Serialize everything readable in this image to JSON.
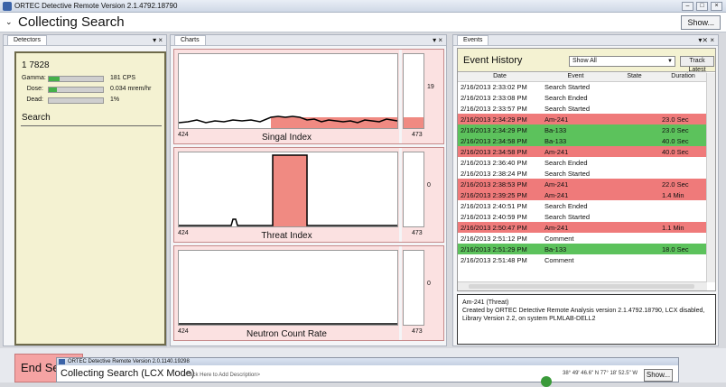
{
  "window": {
    "title": "ORTEC Detective Remote Version 2.1.4792.18790"
  },
  "header": {
    "title": "Collecting Search",
    "show_label": "Show..."
  },
  "panels": {
    "detectors": "Detectors",
    "charts": "Charts",
    "events": "Events",
    "pin": "▾ ×",
    "pin_events": "▾⨯ ×"
  },
  "detector": {
    "id": "1 7828",
    "search_label": "Search",
    "rows": [
      {
        "label": "Gamma:",
        "value": "181 CPS",
        "fill": 0.2
      },
      {
        "label": "Dose:",
        "value": "0.034 mrem/hr",
        "fill": 0.15
      },
      {
        "label": "Dead:",
        "value": "1%",
        "fill": 0
      }
    ]
  },
  "charts": [
    {
      "title": "Singal Index",
      "left": "424",
      "right": "473",
      "side_value": "19"
    },
    {
      "title": "Threat Index",
      "left": "424",
      "right": "473",
      "side_value": "0"
    },
    {
      "title": "Neutron Count Rate",
      "left": "424",
      "right": "473",
      "side_value": "0"
    }
  ],
  "events": {
    "title": "Event History",
    "filter": "Show All",
    "track_label": "Track Latest",
    "columns": [
      "Date",
      "Event",
      "State",
      "Duration"
    ],
    "rows": [
      {
        "date": "2/16/2013 2:33:02 PM",
        "event": "Search Started",
        "state": "",
        "duration": "",
        "color": "white"
      },
      {
        "date": "2/16/2013 2:33:08 PM",
        "event": "Search Ended",
        "state": "",
        "duration": "",
        "color": "white"
      },
      {
        "date": "2/16/2013 2:33:57 PM",
        "event": "Search Started",
        "state": "",
        "duration": "",
        "color": "white"
      },
      {
        "date": "2/16/2013 2:34:29 PM",
        "event": "Am-241",
        "state": "",
        "duration": "23.0 Sec",
        "color": "red"
      },
      {
        "date": "2/16/2013 2:34:29 PM",
        "event": "Ba-133",
        "state": "",
        "duration": "23.0 Sec",
        "color": "green"
      },
      {
        "date": "2/16/2013 2:34:58 PM",
        "event": "Ba-133",
        "state": "",
        "duration": "40.0 Sec",
        "color": "green"
      },
      {
        "date": "2/16/2013 2:34:58 PM",
        "event": "Am-241",
        "state": "",
        "duration": "40.0 Sec",
        "color": "red"
      },
      {
        "date": "2/16/2013 2:36:40 PM",
        "event": "Search Ended",
        "state": "",
        "duration": "",
        "color": "white"
      },
      {
        "date": "2/16/2013 2:38:24 PM",
        "event": "Search Started",
        "state": "",
        "duration": "",
        "color": "white"
      },
      {
        "date": "2/16/2013 2:38:53 PM",
        "event": "Am-241",
        "state": "",
        "duration": "22.0 Sec",
        "color": "red"
      },
      {
        "date": "2/16/2013 2:39:25 PM",
        "event": "Am-241",
        "state": "",
        "duration": "1.4 Min",
        "color": "red"
      },
      {
        "date": "2/16/2013 2:40:51 PM",
        "event": "Search Ended",
        "state": "",
        "duration": "",
        "color": "white"
      },
      {
        "date": "2/16/2013 2:40:59 PM",
        "event": "Search Started",
        "state": "",
        "duration": "",
        "color": "white"
      },
      {
        "date": "2/16/2013 2:50:47 PM",
        "event": "Am-241",
        "state": "",
        "duration": "1.1 Min",
        "color": "red"
      },
      {
        "date": "2/16/2013 2:51:12 PM",
        "event": "Comment",
        "state": "",
        "duration": "",
        "color": "white"
      },
      {
        "date": "2/16/2013 2:51:29 PM",
        "event": "Ba-133",
        "state": "",
        "duration": "18.0 Sec",
        "color": "green"
      },
      {
        "date": "2/16/2013 2:51:48 PM",
        "event": "Comment",
        "state": "",
        "duration": "",
        "color": "white"
      }
    ],
    "description": {
      "line1": "Am-241 (Threat)",
      "line2": "Created by ORTEC Detective Remote Analysis version 2.1.4792.18790, LCX  disabled,",
      "line3": "Library Version 2.2, on system PLMLAB-DELL2"
    }
  },
  "footer": {
    "end_label": "End Se"
  },
  "sub_window": {
    "titlebar": "ORTEC Detective Remote Version 2.0.1140.19298",
    "title": "Collecting Search (LCX Mode)",
    "description_placeholder": "<Click Here to Add Description>",
    "coords": "38° 49' 46.6\" N 77° 18' 52.5\" W",
    "show_label": "Show..."
  },
  "colors": {
    "red": "#ef7a7a",
    "green": "#5cc25c",
    "white": "#ffffff",
    "alarm": "#f08a82"
  }
}
